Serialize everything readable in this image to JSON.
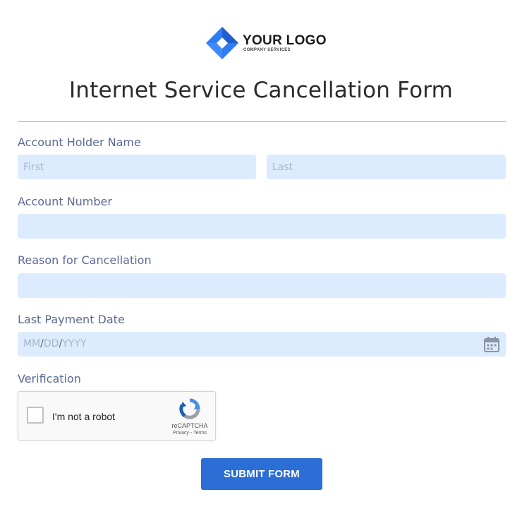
{
  "logo": {
    "title": "YOUR LOGO",
    "subtitle": "COMPANY SERVICES",
    "mark_color_dark": "#1f5fcf",
    "mark_color_light": "#3d8bff"
  },
  "form": {
    "title": "Internet Service Cancellation Form",
    "fields": {
      "account_holder": {
        "label": "Account Holder Name",
        "first_placeholder": "First",
        "last_placeholder": "Last"
      },
      "account_number": {
        "label": "Account Number",
        "value": ""
      },
      "reason": {
        "label": "Reason for Cancellation",
        "value": ""
      },
      "last_payment_date": {
        "label": "Last Payment Date",
        "mm": "MM",
        "dd": "DD",
        "yyyy": "YYYY",
        "separator": "/",
        "icon": "calendar-icon"
      },
      "verification": {
        "label": "Verification",
        "captcha_label": "I'm not a robot",
        "captcha_brand": "reCAPTCHA",
        "captcha_links": "Privacy - Terms",
        "checked": false
      }
    },
    "submit_label": "SUBMIT FORM"
  },
  "colors": {
    "input_bg": "#dcebfd",
    "label": "#5a6a94",
    "button": "#2b6ed6"
  }
}
